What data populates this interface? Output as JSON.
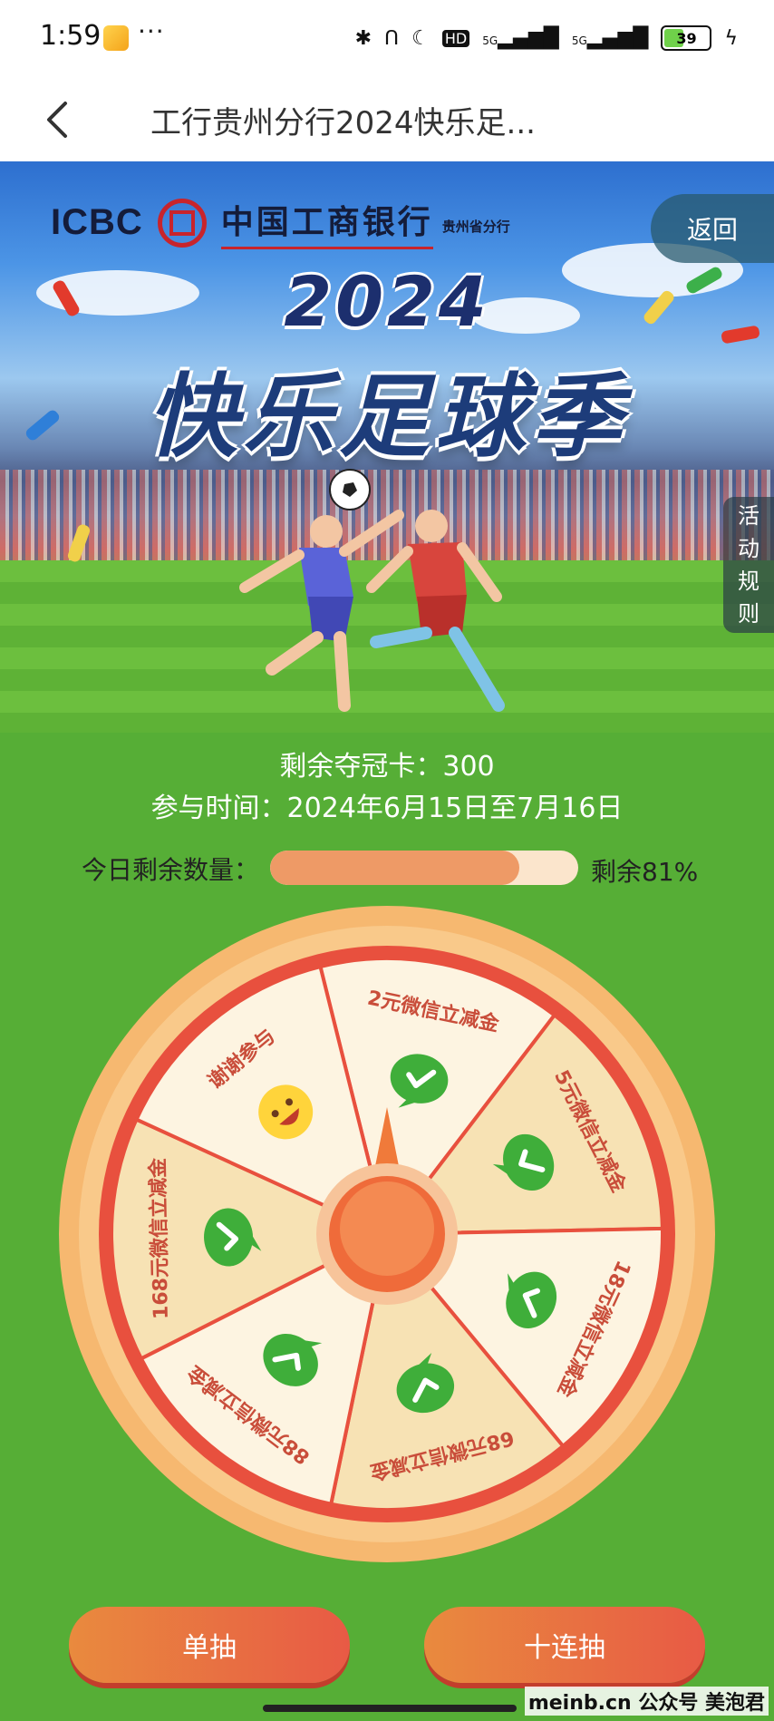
{
  "status_bar": {
    "time": "1:59",
    "dots": "···",
    "net_label": "5G",
    "net_label2": "5G",
    "hd_label": "HD",
    "battery": "39"
  },
  "nav": {
    "title": "工行贵州分行2024快乐足..."
  },
  "banner": {
    "icbc_text": "ICBC",
    "bank_name": "中国工商银行",
    "branch": "贵州省分行",
    "title_year": "2024",
    "title_main": "快乐足球季",
    "return_label": "返回",
    "rules_label": [
      "活",
      "动",
      "规",
      "则"
    ]
  },
  "info": {
    "remaining_cards": "剩余夺冠卡：300",
    "period": "参与时间：2024年6月15日至7月16日",
    "today_label": "今日剩余数量：",
    "today_remaining_text": "剩余81%",
    "today_remaining_fraction": 0.81
  },
  "wheel": {
    "segments": [
      {
        "label": "2元微信立减金",
        "icon": "wechat-icon"
      },
      {
        "label": "5元微信立减金",
        "icon": "wechat-icon"
      },
      {
        "label": "18元微信立减金",
        "icon": "wechat-icon"
      },
      {
        "label": "68元微信立减金",
        "icon": "wechat-icon"
      },
      {
        "label": "88元微信立减金",
        "icon": "wechat-icon"
      },
      {
        "label": "168元微信立减金",
        "icon": "wechat-icon"
      },
      {
        "label": "谢谢参与",
        "icon": "smiley-icon"
      }
    ]
  },
  "buttons": {
    "single": "单抽",
    "ten": "十连抽"
  },
  "watermark": "meinb.cn  公众号 美泡君",
  "colors": {
    "green_bg": "#56ae36",
    "segment_light": "#fdf4e1",
    "segment_dark": "#f7e2b4",
    "wheel_rim": "#e8503e",
    "button": "#e8733f"
  }
}
